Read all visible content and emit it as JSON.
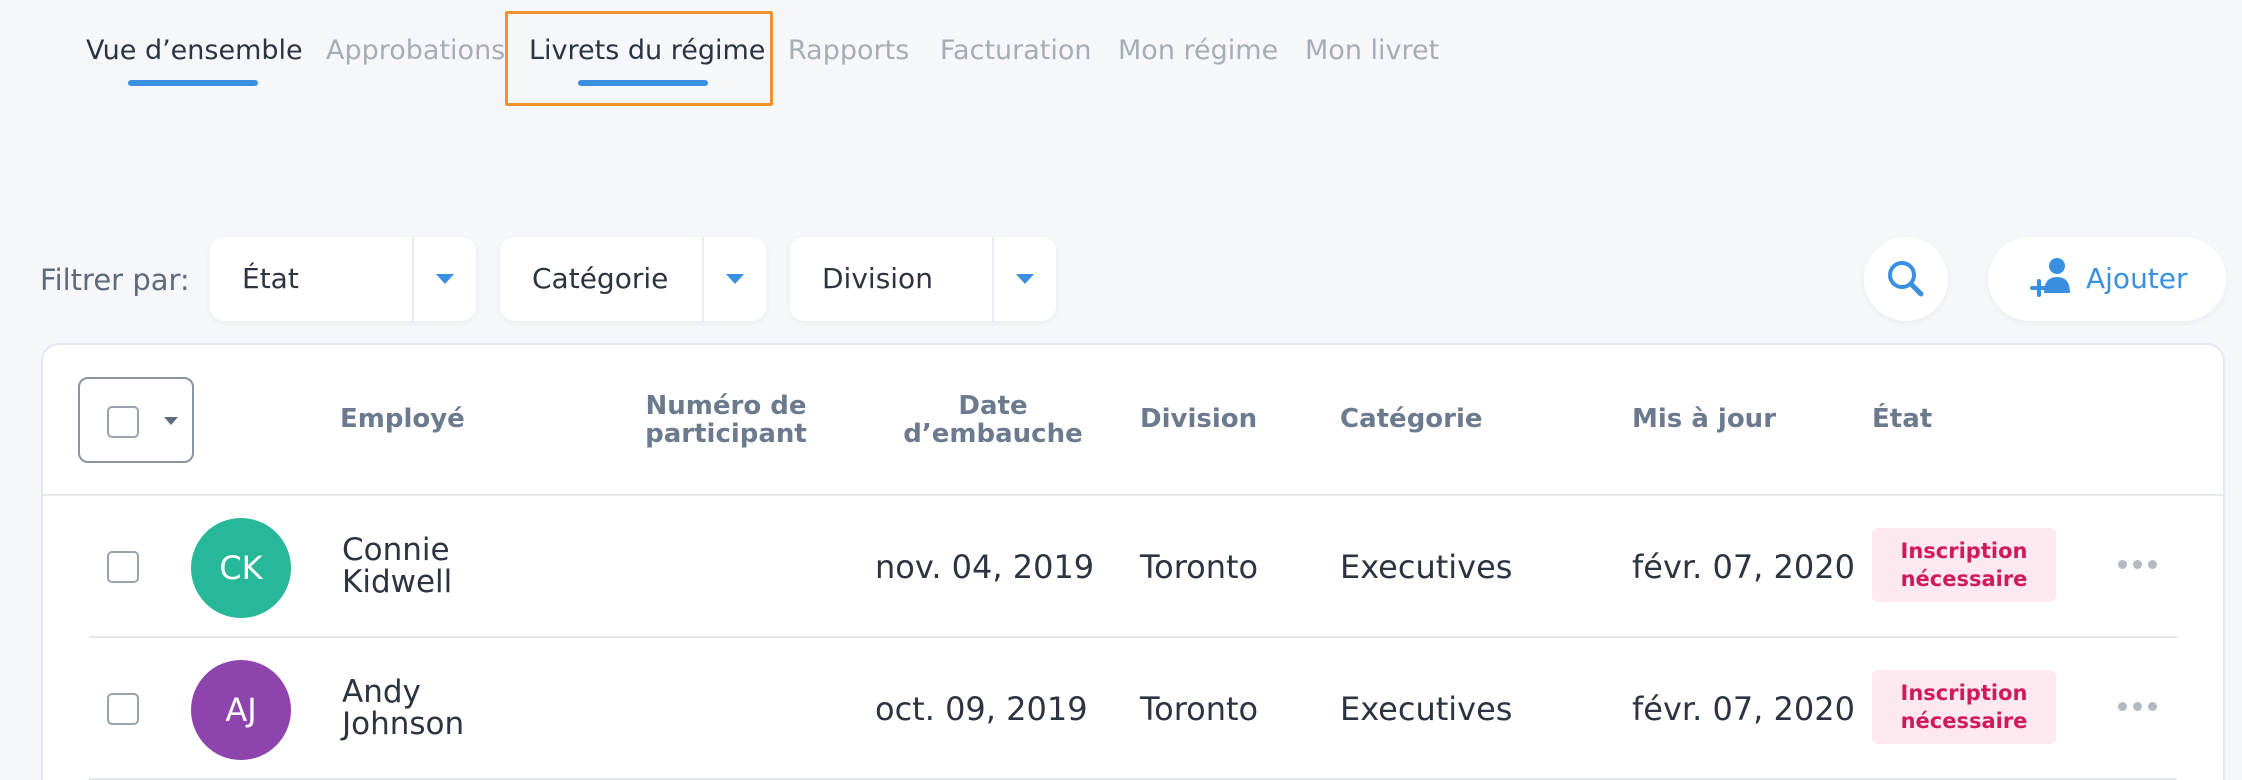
{
  "tabs": [
    {
      "label": "Vue d’ensemble",
      "active": true
    },
    {
      "label": "Approbations",
      "active": false
    },
    {
      "label": "Livrets du régime",
      "active": true
    },
    {
      "label": "Rapports",
      "active": false
    },
    {
      "label": "Facturation",
      "active": false
    },
    {
      "label": "Mon régime",
      "active": false
    },
    {
      "label": "Mon livret",
      "active": false
    }
  ],
  "filters": {
    "label": "Filtrer par:",
    "dropdowns": [
      {
        "label": "État"
      },
      {
        "label": "Catégorie"
      },
      {
        "label": "Division"
      }
    ]
  },
  "actions": {
    "search_icon": "search-icon",
    "add_label": "Ajouter",
    "add_icon": "add-user-icon"
  },
  "table": {
    "columns": {
      "employee": "Employé",
      "participant_1": "Numéro de",
      "participant_2": "participant",
      "hire_1": "Date",
      "hire_2": "d’embauche",
      "division": "Division",
      "category": "Catégorie",
      "updated": "Mis à jour",
      "state": "État"
    },
    "rows": [
      {
        "initials": "CK",
        "avatar_color": "#26b899",
        "first_name": "Connie",
        "last_name": "Kidwell",
        "participant_number": "",
        "hire_date": "nov. 04, 2019",
        "division": "Toronto",
        "category": "Executives",
        "updated": "févr. 07, 2020",
        "status_1": "Inscription",
        "status_2": "nécessaire"
      },
      {
        "initials": "AJ",
        "avatar_color": "#8e44ad",
        "first_name": "Andy",
        "last_name": "Johnson",
        "participant_number": "",
        "hire_date": "oct. 09, 2019",
        "division": "Toronto",
        "category": "Executives",
        "updated": "févr. 07, 2020",
        "status_1": "Inscription",
        "status_2": "nécessaire"
      }
    ]
  },
  "colors": {
    "accent": "#3a8fe0",
    "highlight": "#f0922b",
    "status_text": "#d11a5c",
    "status_bg": "#fde9ef"
  }
}
